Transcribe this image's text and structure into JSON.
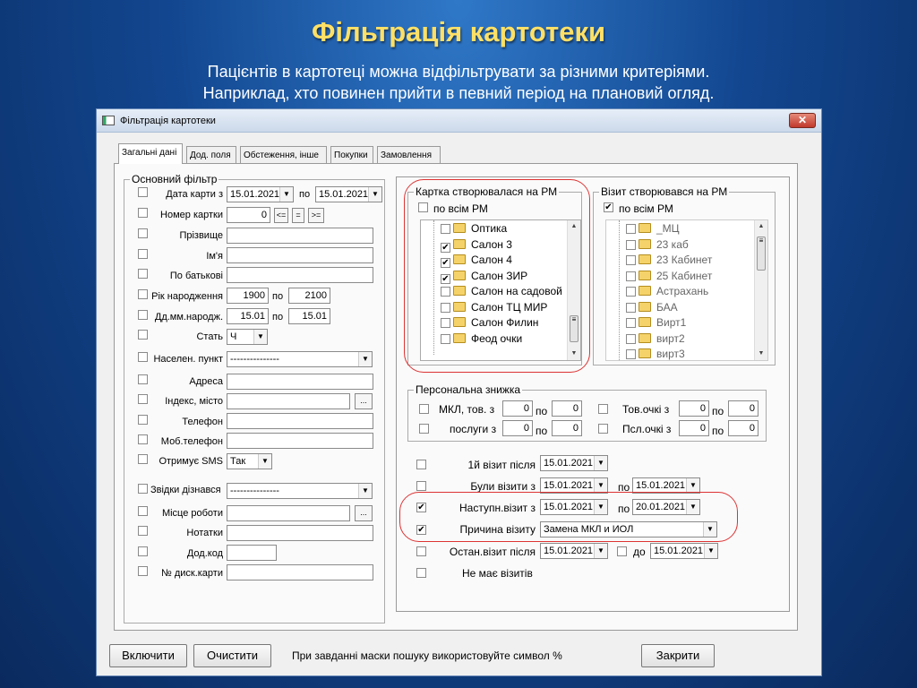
{
  "slide": {
    "title": "Фільтрація картотеки",
    "subtitle_line1": "Пацієнтів в картотеці можна відфільтрувати за різними критеріями.",
    "subtitle_line2": "Наприклад, хто повинен прийти в певний період на плановий огляд."
  },
  "window": {
    "title": "Фільтрація картотеки",
    "close": "✕"
  },
  "tabs": [
    "Загальні дані",
    "Дод. поля",
    "Обстеження, інше",
    "Покупки",
    "Замовлення"
  ],
  "basic_filter": {
    "caption": "Основний фільтр",
    "card_date_label": "Дата карти з",
    "card_date_from": "15.01.2021",
    "po": "по",
    "card_date_to": "15.01.2021",
    "card_number_label": "Номер картки",
    "card_number_value": "0",
    "btn_le": "<=",
    "btn_eq": "=",
    "btn_ge": ">=",
    "surname_label": "Прізвище",
    "name_label": "Ім'я",
    "patronymic_label": "По батькові",
    "birth_year_label": "Рік народження",
    "birth_year_from": "1900",
    "birth_year_to": "2100",
    "birth_ddmm_label": "Дд.мм.народж.",
    "birth_ddmm_from": "15.01",
    "birth_ddmm_to": "15.01",
    "sex_label": "Стать",
    "sex_value": "Ч",
    "settlement_label": "Населен. пункт",
    "settlement_value": "---------------",
    "address_label": "Адреса",
    "index_label": "Індекс, місто",
    "ellipsis": "...",
    "phone_label": "Телефон",
    "mobile_label": "Моб.телефон",
    "sms_label": "Отримує SMS",
    "sms_value": "Так",
    "source_label": "Звідки дізнався",
    "source_value": "---------------",
    "work_label": "Місце роботи",
    "notes_label": "Нотатки",
    "addcode_label": "Дод.код",
    "disc_card_label": "№ диск.карти"
  },
  "card_created": {
    "caption": "Картка створювалася на РМ",
    "all_label": "по всім РМ",
    "items": [
      {
        "label": "Оптика",
        "checked": false
      },
      {
        "label": "Салон 3",
        "checked": true
      },
      {
        "label": "Салон 4",
        "checked": true
      },
      {
        "label": "Салон ЗИР",
        "checked": true
      },
      {
        "label": "Салон на садовой",
        "checked": false
      },
      {
        "label": "Салон ТЦ МИР",
        "checked": false
      },
      {
        "label": "Салон Филин",
        "checked": false
      },
      {
        "label": "Феод очки",
        "checked": false
      }
    ]
  },
  "visit_created": {
    "caption": "Візит створювався на РМ",
    "all_label": "по всім РМ",
    "items": [
      {
        "label": "_МЦ"
      },
      {
        "label": "23 каб"
      },
      {
        "label": "23 Кабинет"
      },
      {
        "label": "25 Кабинет"
      },
      {
        "label": "Астрахань"
      },
      {
        "label": "БАА"
      },
      {
        "label": "Вирт1"
      },
      {
        "label": "вирт2"
      },
      {
        "label": "вирт3"
      }
    ]
  },
  "discount": {
    "caption": "Персональна знижка",
    "mkl_label": "МКЛ, тов. з",
    "services_label": "послуги з",
    "tov_label": "Тов.очкі з",
    "psl_label": "Псл.очкі з",
    "po": "по",
    "zero": "0"
  },
  "visits": {
    "first_visit_label": "1й візит після",
    "first_visit_date": "15.01.2021",
    "were_visits_label": "Були візити з",
    "were_from": "15.01.2021",
    "po": "по",
    "were_to": "15.01.2021",
    "next_visit_label": "Наступн.візит з",
    "next_from": "15.01.2021",
    "next_to": "20.01.2021",
    "reason_label": "Причина візиту",
    "reason_value": "Замена МКЛ и ИОЛ",
    "last_visit_label": "Остан.візит після",
    "last_from": "15.01.2021",
    "do": "до",
    "last_to": "15.01.2021",
    "no_visits_label": "Не має візитів"
  },
  "footer": {
    "enable": "Включити",
    "clear": "Очистити",
    "hint": "При завданні маски пошуку використовуйте символ %",
    "close": "Закрити"
  },
  "colors": {
    "title": "#ffe066",
    "highlight": "#dd3333"
  }
}
